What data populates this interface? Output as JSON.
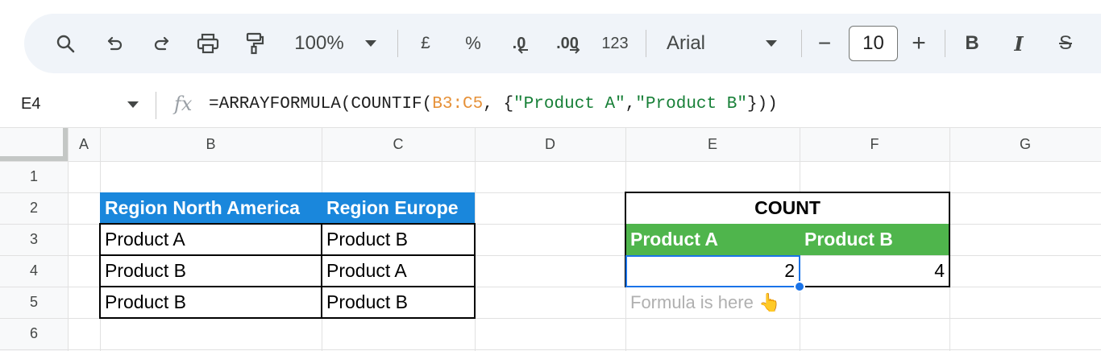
{
  "toolbar": {
    "zoom": "100%",
    "currency": "£",
    "percent": "%",
    "decrease_decimal": ".0",
    "increase_decimal": ".00",
    "number_format": "123",
    "font_name": "Arial",
    "font_size": "10",
    "font_size_minus": "−",
    "font_size_plus": "+",
    "bold": "B",
    "italic": "I",
    "strikethrough": "S"
  },
  "formula_bar": {
    "cell_ref": "E4",
    "fx": "fx",
    "formula_prefix": "=ARRAYFORMULA(COUNTIF(",
    "formula_range": "B3:C5",
    "formula_mid": ", {",
    "formula_str1": "\"Product A\"",
    "formula_comma": ",",
    "formula_str2": "\"Product B\"",
    "formula_suffix": "}))"
  },
  "columns": [
    "A",
    "B",
    "C",
    "D",
    "E",
    "F",
    "G"
  ],
  "rows": [
    "1",
    "2",
    "3",
    "4",
    "5",
    "6"
  ],
  "cells": {
    "B2": "Region North America",
    "C2": "Region Europe",
    "B3": "Product A",
    "C3": "Product B",
    "B4": "Product B",
    "C4": "Product A",
    "B5": "Product B",
    "C5": "Product B",
    "E2": "COUNT",
    "E3": "Product A",
    "F3": "Product B",
    "E4": "2",
    "F4": "4",
    "E5": "Formula is here 👆"
  },
  "colors": {
    "blue_header": "#1a87dc",
    "green_header": "#4fb54c",
    "selection": "#1a73e8",
    "range_highlight": "#e69138",
    "string_literal": "#188038"
  }
}
